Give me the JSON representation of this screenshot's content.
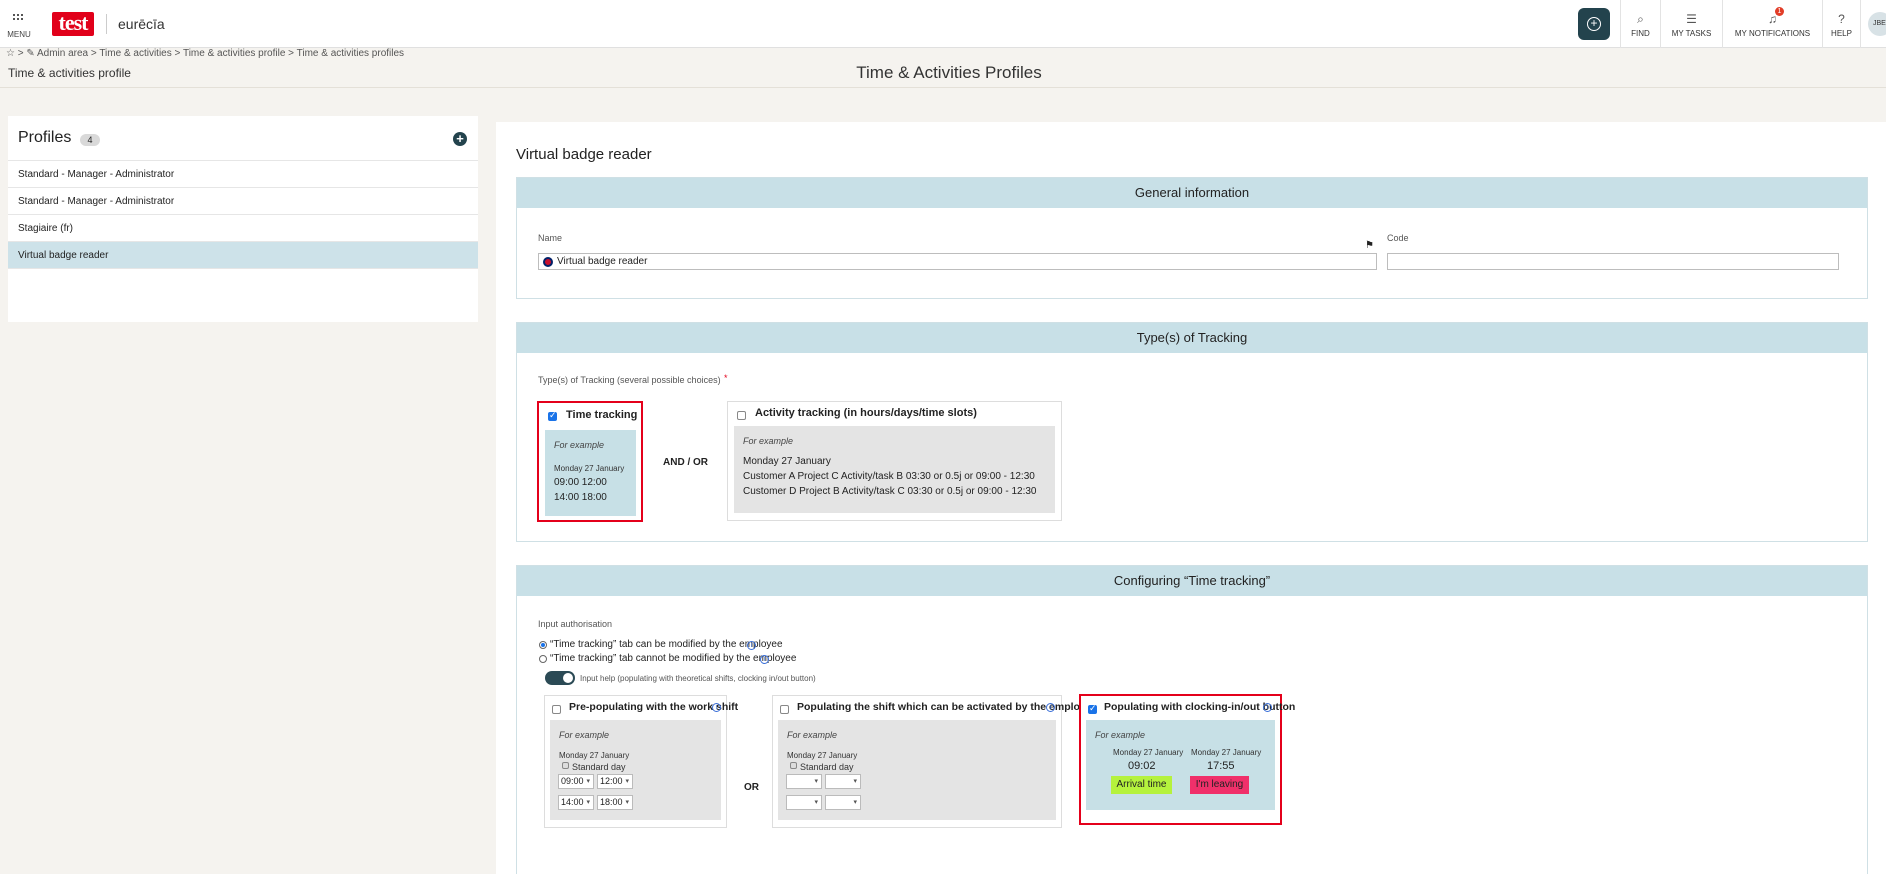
{
  "topbar": {
    "menu_label": "MENU",
    "logo_test": "test",
    "logo_eurecia": "eurēcīa",
    "find_label": "FIND",
    "tasks_label": "MY TASKS",
    "notifications_label": "MY NOTIFICATIONS",
    "notifications_count": "1",
    "help_label": "HELP",
    "avatar_initials": "JBE"
  },
  "breadcrumb": "☆ > ✎ Admin area > Time & activities > Time & activities profile > Time & activities profiles",
  "page": {
    "subtitle": "Time & activities profile",
    "title": "Time & Activities Profiles"
  },
  "profiles": {
    "title": "Profiles",
    "count": "4",
    "items": [
      "Standard - Manager - Administrator",
      "Standard - Manager - Administrator",
      "Stagiaire (fr)",
      "Virtual badge reader"
    ]
  },
  "main": {
    "title": "Virtual badge reader",
    "general": {
      "header": "General information",
      "name_label": "Name",
      "name_value": "Virtual badge reader",
      "code_label": "Code",
      "code_value": ""
    },
    "tracking": {
      "header": "Type(s) of Tracking",
      "field_label": "Type(s) of Tracking (several possible choices)",
      "required_mark": "*",
      "time_label": "Time tracking",
      "for_example": "For example",
      "time_date": "Monday 27 January",
      "time_row1": "09:00  12:00",
      "time_row2": "14:00  18:00",
      "and_or": "AND / OR",
      "activity_label": "Activity tracking (in hours/days/time slots)",
      "act_date": "Monday 27 January",
      "act_row1": "Customer A  Project C  Activity/task B  03:30 or 0.5j or 09:00 - 12:30",
      "act_row2": "Customer D  Project B  Activity/task C  03:30 or 0.5j or 09:00 - 12:30"
    },
    "config": {
      "header": "Configuring “Time tracking”",
      "auth_label": "Input authorisation",
      "radio1": "“Time tracking” tab can be modified by the employee",
      "radio2": "“Time tracking” tab cannot be modified by the employee",
      "input_help": "Input help (populating with theoretical shifts, clocking in/out button)",
      "prepop_label": "Pre-populating with the work shift",
      "or_label": "OR",
      "shift_label": "Populating the shift which can be activated by the employee",
      "clock_label": "Populating with clocking-in/out button",
      "for_example": "For example",
      "date": "Monday 27 January",
      "standard_day": "Standard day",
      "sel_0900": "09:00",
      "sel_1200": "12:00",
      "sel_1400": "14:00",
      "sel_1800": "18:00",
      "arrival_time_value": "09:02",
      "leaving_time_value": "17:55",
      "arrival_button": "Arrival time",
      "leaving_button": "I'm leaving"
    }
  },
  "colors": {
    "accent": "#23434d",
    "section_header": "#c8e0e7",
    "highlight_red": "#e4001b",
    "arrival_green": "#b5f23d",
    "leaving_pink": "#f0306a"
  }
}
